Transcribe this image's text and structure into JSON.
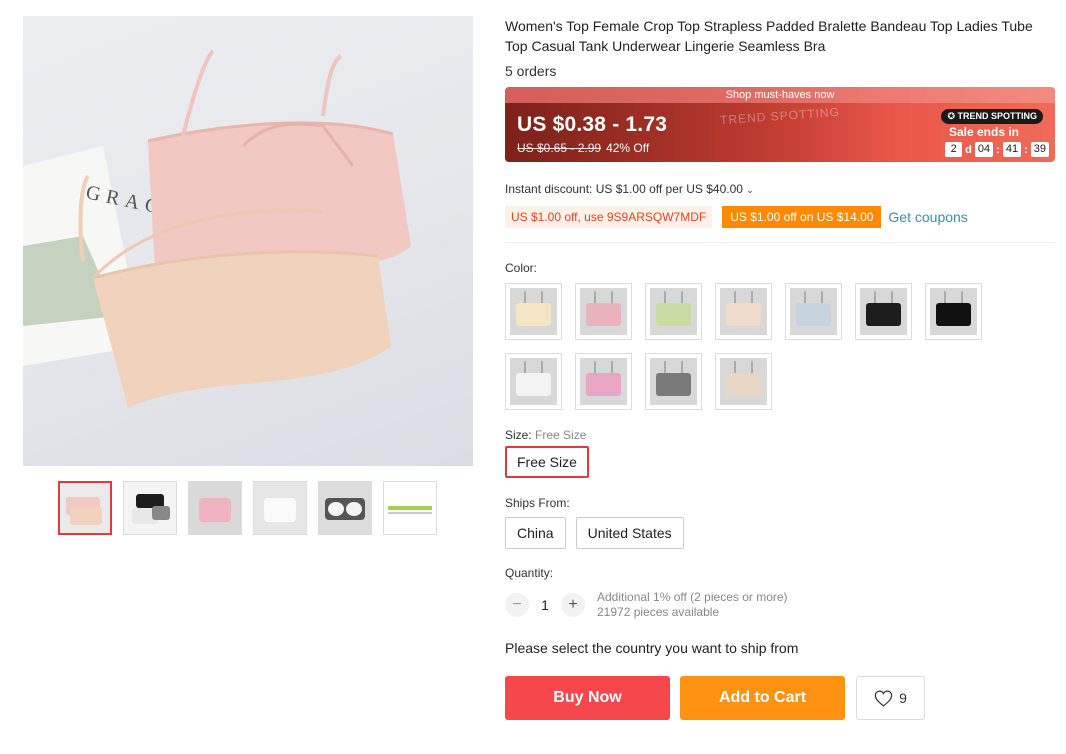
{
  "product": {
    "title": "Women's Top Female Crop Top Strapless Padded Bralette Bandeau Top Ladies Tube Top Casual Tank Underwear Lingerie Seamless Bra",
    "orders": "5 orders"
  },
  "gallery": {
    "main_image_text": "GRAC",
    "thumbnails": [
      "nude-pink-pair",
      "black-white-pair",
      "pink",
      "white",
      "grey-cups",
      "size-chart"
    ]
  },
  "price": {
    "banner_caption": "Shop must-haves now",
    "range": "US $0.38 - 1.73",
    "original": "US $0.65 - 2.99",
    "discount": "42% Off",
    "watermark": "TREND SPOTTING",
    "badge": "TREND SPOTTING",
    "sale_ends": "Sale ends in",
    "countdown": {
      "days": "2",
      "days_unit": "d",
      "hours": "04",
      "minutes": "41",
      "seconds": "39",
      "sep": ":"
    },
    "colors": {
      "banner_dark": "#c8322e",
      "banner_light": "#ef6b5a"
    }
  },
  "promotions": {
    "instant_discount": "Instant discount: US $1.00 off per US $40.00",
    "coupon_code": "US $1.00 off, use 9S9ARSQW7MDF",
    "coupon_threshold": "US $1.00 off on US $14.00",
    "get_coupons": "Get coupons"
  },
  "color": {
    "label": "Color:",
    "swatches": [
      "#f4e6c2",
      "#e8b3bd",
      "#c9dca4",
      "#f0dccb",
      "#c7d3df",
      "#1d1d1d",
      "#111111",
      "#f3f3f3",
      "#e9a6c2",
      "#7a7a7a",
      "#e9d7c6"
    ]
  },
  "size": {
    "label": "Size:",
    "selected_name": "Free Size",
    "options": [
      "Free Size"
    ]
  },
  "shipping": {
    "label": "Ships From:",
    "options": [
      "China",
      "United States"
    ]
  },
  "quantity": {
    "label": "Quantity:",
    "minus": "−",
    "plus": "+",
    "value": "1",
    "note_line1": "Additional 1% off (2 pieces or more)",
    "note_line2": "21972 pieces available"
  },
  "ship_message": "Please select the country you want to ship from",
  "actions": {
    "buy_now": "Buy Now",
    "add_to_cart": "Add to Cart",
    "wishlist_count": "9"
  },
  "theme": {
    "accent": "#e4393c",
    "buy": "#f5474c",
    "cart": "#ff9212",
    "link": "#3d8ea8"
  }
}
